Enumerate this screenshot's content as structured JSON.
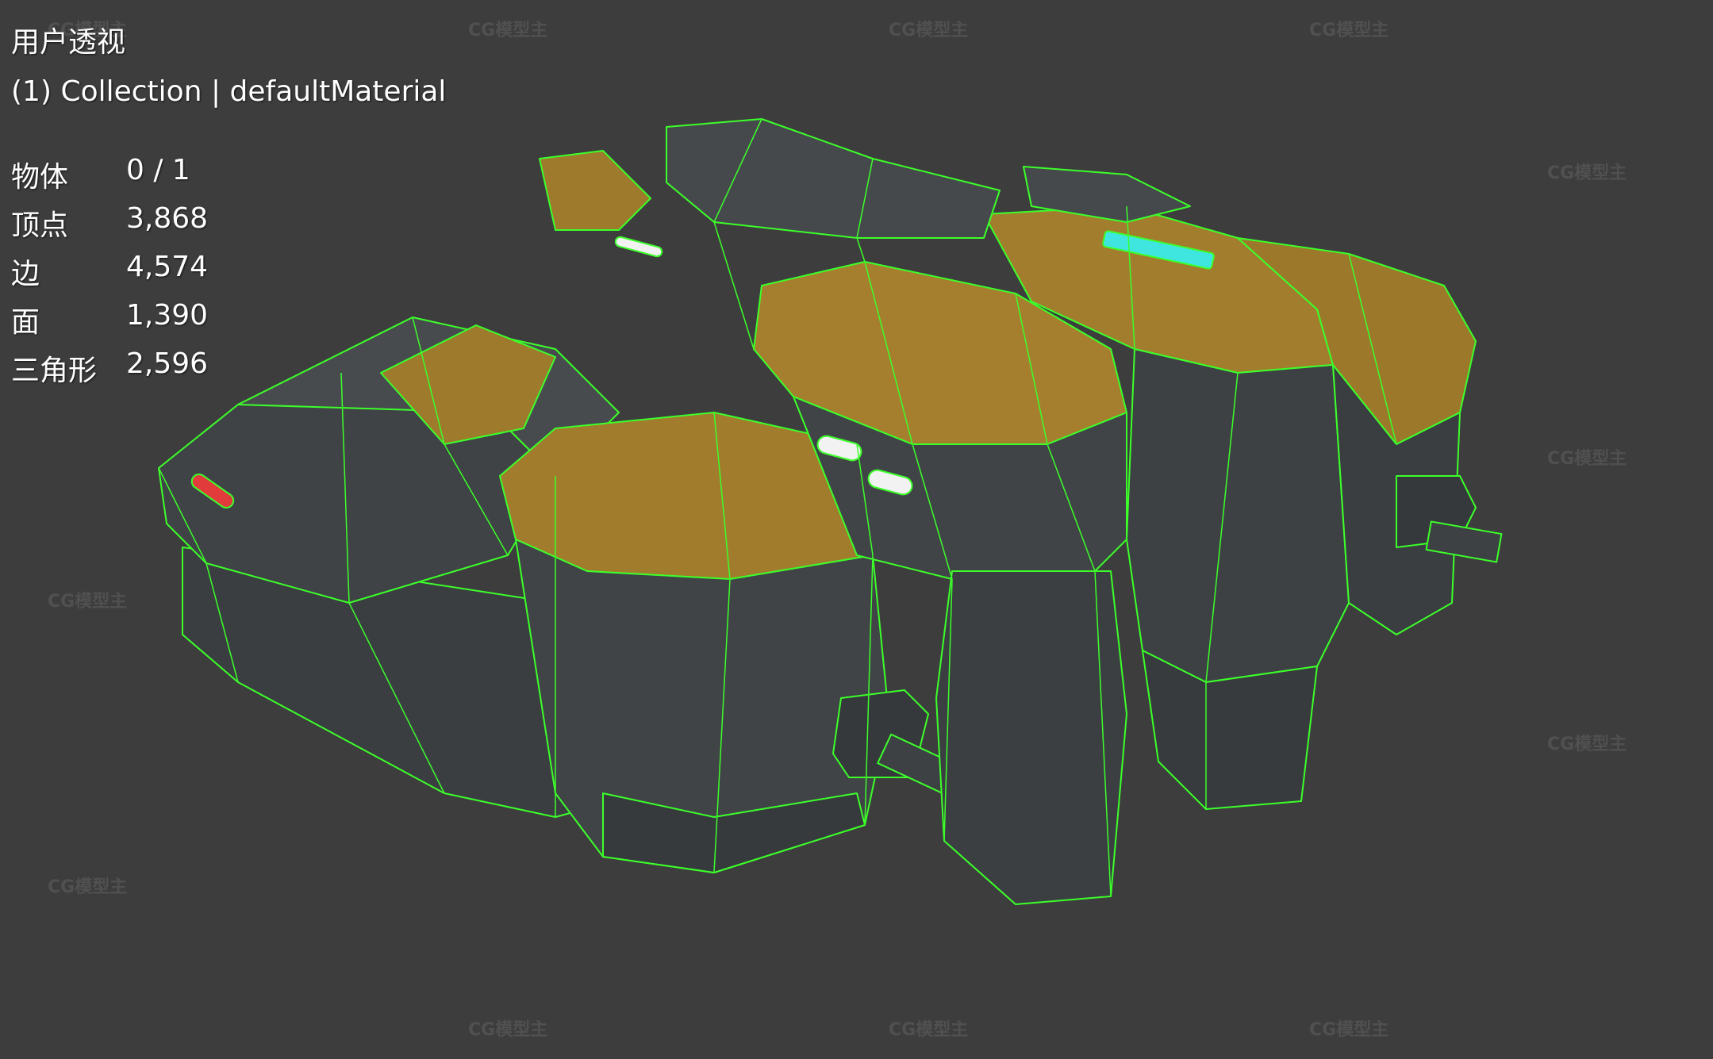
{
  "viewport": {
    "view_name": "用户透视",
    "collection_label": "(1) Collection | defaultMaterial"
  },
  "stats": {
    "objects": {
      "label": "物体",
      "value": "0 / 1"
    },
    "vertices": {
      "label": "顶点",
      "value": "3,868"
    },
    "edges": {
      "label": "边",
      "value": "4,574"
    },
    "faces": {
      "label": "面",
      "value": "1,390"
    },
    "triangles": {
      "label": "三角形",
      "value": "2,596"
    }
  },
  "watermark": {
    "text": "CG模型主"
  },
  "colors": {
    "background": "#3d3d3d",
    "wireframe": "#3cff2a",
    "hull_metal": "#3b3f42",
    "hull_armor": "#a07a2a",
    "light_white": "#f2f2f2",
    "light_cyan": "#3fe6e0",
    "light_red": "#e23b3b"
  }
}
